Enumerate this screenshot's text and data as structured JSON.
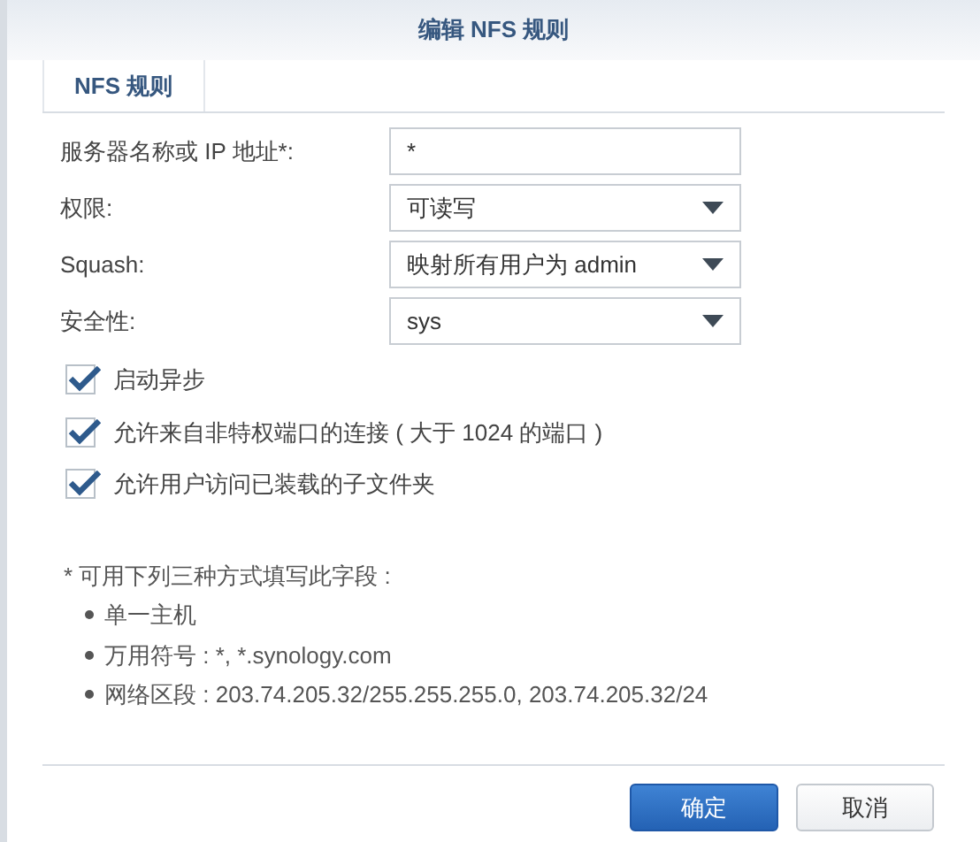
{
  "window": {
    "title": "编辑 NFS 规则"
  },
  "tabs": [
    {
      "label": "NFS 规则",
      "selected": true
    }
  ],
  "fields": [
    {
      "kind": "text",
      "label": "服务器名称或 IP 地址*:",
      "value": "*"
    },
    {
      "kind": "select",
      "label": "权限:",
      "value": "可读写"
    },
    {
      "kind": "select",
      "label": "Squash:",
      "value": "映射所有用户为 admin"
    },
    {
      "kind": "select",
      "label": "安全性:",
      "value": "sys"
    }
  ],
  "checkboxes": [
    {
      "label": "启动异步",
      "checked": true
    },
    {
      "label": "允许来自非特权端口的连接 ( 大于 1024 的端口 )",
      "checked": true
    },
    {
      "label": "允许用户访问已装载的子文件夹",
      "checked": true
    }
  ],
  "note": {
    "heading": "* 可用下列三种方式填写此字段 :",
    "items": [
      "单一主机",
      "万用符号 : *, *.synology.com",
      "网络区段 : 203.74.205.32/255.255.255.0, 203.74.205.32/24"
    ]
  },
  "buttons": [
    {
      "kind": "primary",
      "label": "确定"
    },
    {
      "kind": "secondary",
      "label": "取消"
    }
  ]
}
